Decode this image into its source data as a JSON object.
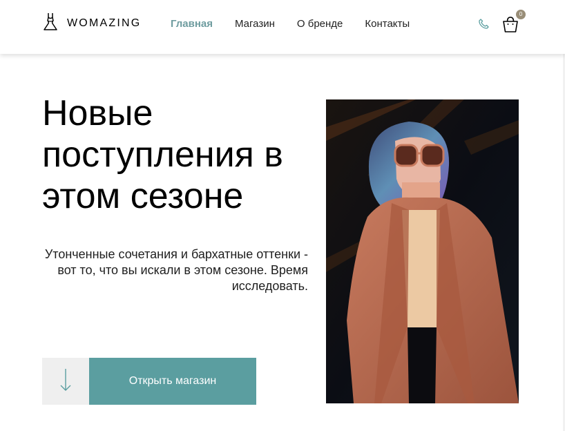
{
  "header": {
    "logo_text": "WOMAZING",
    "nav": [
      {
        "label": "Главная",
        "active": true
      },
      {
        "label": "Магазин",
        "active": false
      },
      {
        "label": "О бренде",
        "active": false
      },
      {
        "label": "Контакты",
        "active": false
      }
    ],
    "cart_count": "0",
    "icons": [
      "dress-logo-icon",
      "phone-icon",
      "shopping-bag-icon"
    ]
  },
  "hero": {
    "title": "Новые поступления в этом сезоне",
    "description": "Утонченные сочетания и бархатные оттенки - вот то, что вы искали в этом сезоне. Время исследовать.",
    "cta_label": "Открыть магазин",
    "scroll_icon": "arrow-down-icon",
    "image": "woman-in-coat-photo"
  },
  "colors": {
    "accent": "#6e9c9f",
    "button": "#5b9ea0",
    "badge": "#998e78",
    "arrow_bg": "#efefef"
  }
}
